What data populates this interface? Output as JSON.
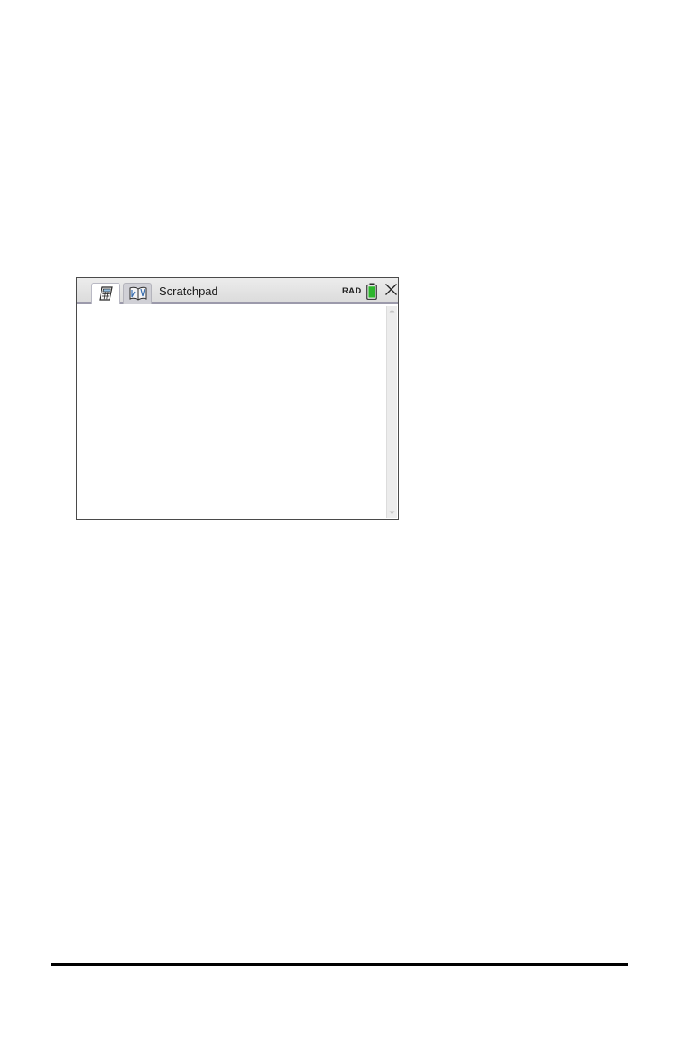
{
  "window": {
    "title": "Scratchpad",
    "mode": "RAD",
    "tabs": [
      {
        "icon": "calculator-icon",
        "active": true
      },
      {
        "icon": "notes-icon",
        "active": false
      }
    ],
    "battery_color": "#2db52d",
    "tab_underline_color": "#9c9aab"
  }
}
